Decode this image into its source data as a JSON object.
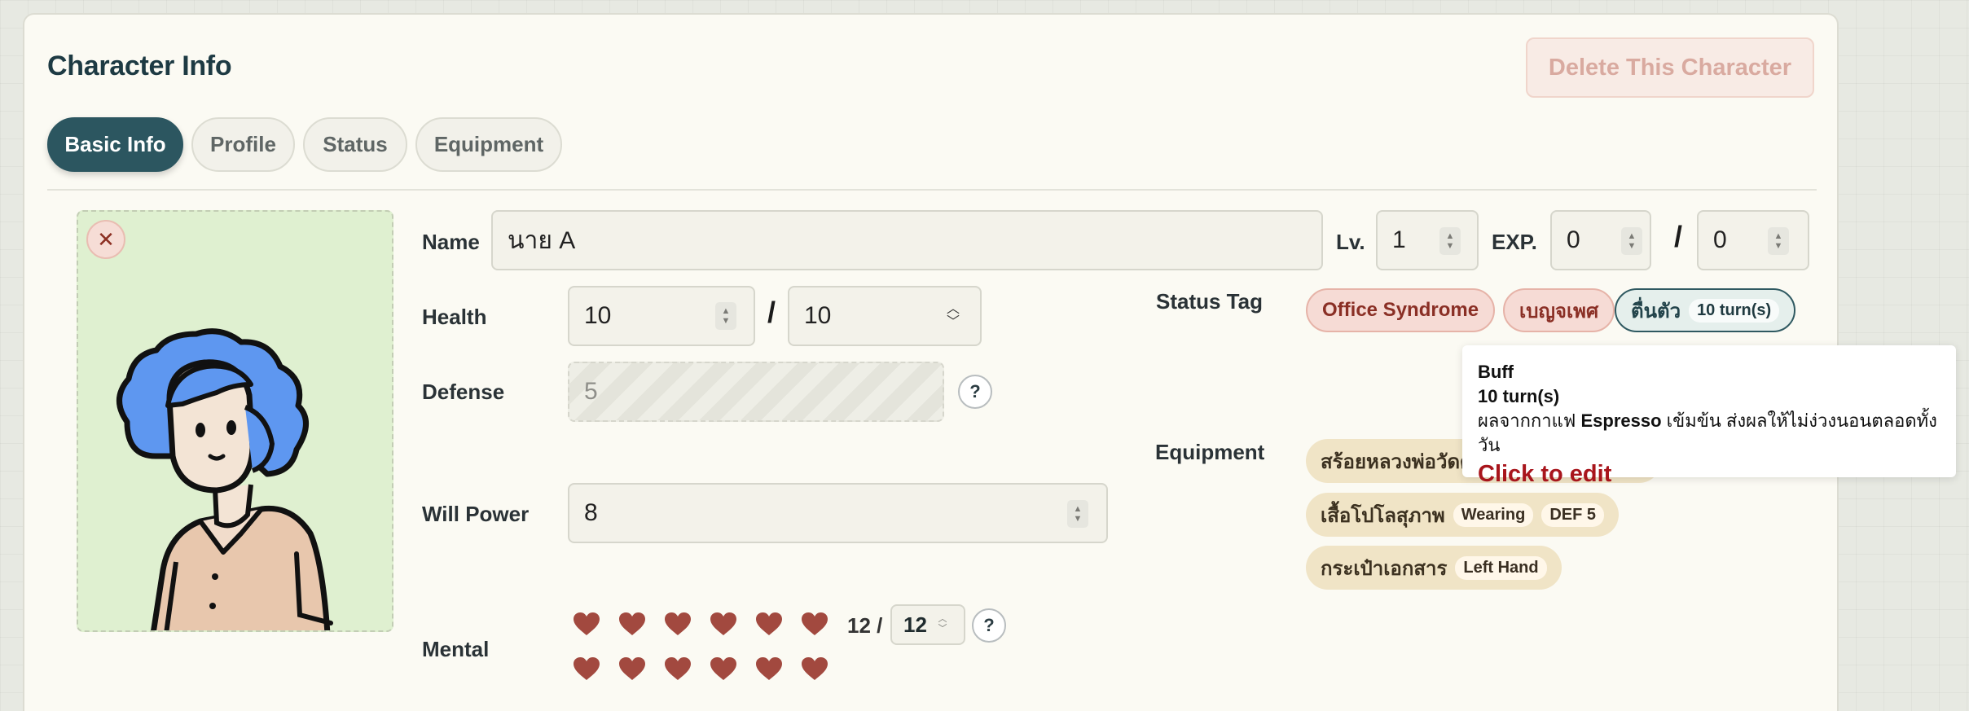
{
  "header": {
    "title": "Character Info",
    "delete_label": "Delete This Character"
  },
  "tabs": [
    {
      "label": "Basic Info",
      "active": true
    },
    {
      "label": "Profile",
      "active": false
    },
    {
      "label": "Status",
      "active": false
    },
    {
      "label": "Equipment",
      "active": false
    }
  ],
  "fields": {
    "name": {
      "label": "Name",
      "value": "นาย A"
    },
    "level": {
      "label": "Lv.",
      "value": "1"
    },
    "exp": {
      "label": "EXP.",
      "current": "0",
      "max": "0"
    },
    "health": {
      "label": "Health",
      "current": "10",
      "max": "10"
    },
    "defense": {
      "label": "Defense",
      "value": "5"
    },
    "will_power": {
      "label": "Will Power",
      "value": "8"
    },
    "mental": {
      "label": "Mental",
      "current": "12",
      "separator": "12 /",
      "max": "12",
      "hearts_filled": 12
    }
  },
  "status_tags": {
    "label": "Status Tag",
    "items": [
      {
        "label": "Office Syndrome",
        "style": "red"
      },
      {
        "label": "เบญจเพศ",
        "style": "red"
      },
      {
        "label": "ตื่นตัว",
        "badge": "10 turn(s)",
        "style": "teal"
      }
    ]
  },
  "tooltip": {
    "type": "Buff",
    "duration": "10 turn(s)",
    "desc_before": "ผลจากกาแฟ ",
    "desc_bold": "Espresso",
    "desc_after": " เข้มข้น ส่งผลให้ไม่ง่วงนอนตลอดทั้งวัน",
    "action": "Click to edit"
  },
  "equipment": {
    "label": "Equipment",
    "items": [
      {
        "name": "สร้อยหลวงพ่อวัดดู"
      },
      {
        "name": "เสื้อโปโลสุภาพ",
        "tags": [
          "Wearing",
          "DEF 5"
        ]
      },
      {
        "name": "กระเป๋าเอกสาร",
        "tags": [
          "Left Hand"
        ]
      }
    ]
  },
  "colors": {
    "accent": "#2c5660",
    "heart": "#a2493f",
    "danger_text": "#a8151c"
  }
}
